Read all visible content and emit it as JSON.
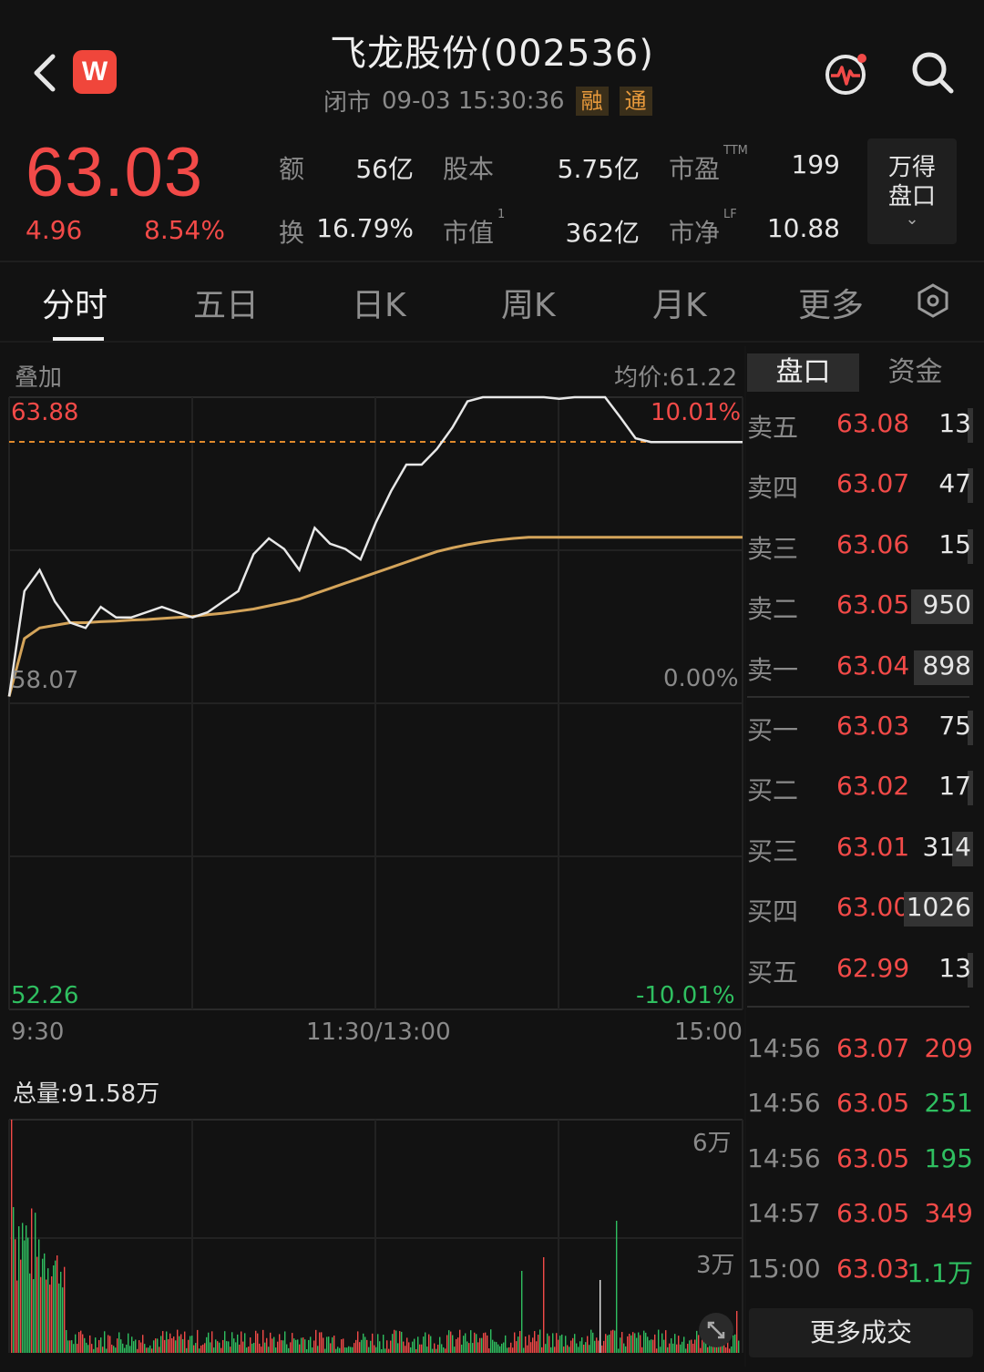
{
  "header": {
    "title": "飞龙股份(002536)",
    "status": "闭市",
    "datetime": "09-03 15:30:36",
    "tags": [
      "融",
      "通"
    ],
    "logo_letter": "W"
  },
  "quote": {
    "price": "63.03",
    "change": "4.96",
    "change_pct": "8.54%",
    "stats": [
      {
        "label": "额",
        "value": "56亿"
      },
      {
        "label": "股本",
        "value": "5.75亿"
      },
      {
        "label": "市盈",
        "sup": "TTM",
        "value": "199"
      },
      {
        "label": "换",
        "value": "16.79%"
      },
      {
        "label": "市值",
        "sup": "1",
        "value": "362亿"
      },
      {
        "label": "市净",
        "sup": "LF",
        "value": "10.88"
      }
    ],
    "wind_button": [
      "万得",
      "盘口"
    ]
  },
  "tabs": [
    "分时",
    "五日",
    "日K",
    "周K",
    "月K",
    "更多"
  ],
  "chart": {
    "overlay_label": "叠加",
    "avg_price": "均价:61.22",
    "high": "63.88",
    "high_pct": "10.01%",
    "prev_close": "58.07",
    "zero_pct": "0.00%",
    "low": "52.26",
    "low_pct": "-10.01%",
    "time_labels": [
      "9:30",
      "11:30/13:00",
      "15:00"
    ],
    "volume_total": "总量:91.58万",
    "vol_ticks": [
      "6万",
      "3万"
    ]
  },
  "chart_data": {
    "type": "line",
    "y_range": [
      52.26,
      63.88
    ],
    "prev_close": 58.07,
    "x": [
      0,
      5,
      10,
      15,
      20,
      25,
      30,
      35,
      40,
      45,
      50,
      55,
      60,
      65,
      70,
      75,
      80,
      85,
      90,
      95,
      100,
      105,
      110,
      115,
      120,
      125,
      130,
      135,
      140,
      145,
      150,
      155,
      160,
      165,
      170,
      175,
      180,
      185,
      190,
      195,
      200,
      205,
      210,
      215,
      220,
      225,
      230,
      235,
      240
    ],
    "series": [
      {
        "values": [
          58.2,
          60.2,
          60.6,
          60.0,
          59.6,
          59.5,
          59.9,
          59.7,
          59.7,
          59.8,
          59.9,
          59.8,
          59.7,
          59.8,
          60.0,
          60.2,
          60.9,
          61.2,
          61.0,
          60.6,
          61.4,
          61.1,
          61.0,
          60.8,
          61.5,
          62.1,
          62.6,
          62.6,
          62.9,
          63.3,
          63.8,
          63.88,
          63.88,
          63.88,
          63.88,
          63.88,
          63.85,
          63.88,
          63.88,
          63.88,
          63.5,
          63.1,
          63.03,
          63.03,
          63.03,
          63.03,
          63.03,
          63.03,
          63.03
        ]
      },
      {
        "values": [
          58.2,
          59.3,
          59.5,
          59.55,
          59.6,
          59.6,
          59.62,
          59.63,
          59.65,
          59.66,
          59.68,
          59.7,
          59.72,
          59.75,
          59.78,
          59.82,
          59.86,
          59.92,
          59.98,
          60.05,
          60.15,
          60.25,
          60.35,
          60.45,
          60.55,
          60.65,
          60.75,
          60.85,
          60.95,
          61.02,
          61.08,
          61.13,
          61.17,
          61.2,
          61.22,
          61.22,
          61.22,
          61.22,
          61.22,
          61.22,
          61.22,
          61.22,
          61.22,
          61.22,
          61.22,
          61.22,
          61.22,
          61.22,
          61.22
        ]
      }
    ]
  },
  "orderbook": {
    "tabs": [
      "盘口",
      "资金"
    ],
    "asks": [
      {
        "label": "卖五",
        "price": "63.08",
        "vol": "13",
        "bar": 0.02
      },
      {
        "label": "卖四",
        "price": "63.07",
        "vol": "47",
        "bar": 0.05
      },
      {
        "label": "卖三",
        "price": "63.06",
        "vol": "15",
        "bar": 0.02
      },
      {
        "label": "卖二",
        "price": "63.05",
        "vol": "950",
        "bar": 0.9
      },
      {
        "label": "卖一",
        "price": "63.04",
        "vol": "898",
        "bar": 0.86
      }
    ],
    "bids": [
      {
        "label": "买一",
        "price": "63.03",
        "vol": "75",
        "bar": 0.07
      },
      {
        "label": "买二",
        "price": "63.02",
        "vol": "17",
        "bar": 0.02
      },
      {
        "label": "买三",
        "price": "63.01",
        "vol": "314",
        "bar": 0.3
      },
      {
        "label": "买四",
        "price": "63.00",
        "vol": "1026",
        "bar": 1.0
      },
      {
        "label": "买五",
        "price": "62.99",
        "vol": "13",
        "bar": 0.02
      }
    ]
  },
  "trades": [
    {
      "time": "14:56",
      "price": "63.07",
      "vol": "209",
      "dir": "up"
    },
    {
      "time": "14:56",
      "price": "63.05",
      "vol": "251",
      "dir": "down"
    },
    {
      "time": "14:56",
      "price": "63.05",
      "vol": "195",
      "dir": "down"
    },
    {
      "time": "14:57",
      "price": "63.05",
      "vol": "349",
      "dir": "up"
    },
    {
      "time": "15:00",
      "price": "63.03",
      "vol": "1.1万",
      "dir": "down"
    }
  ],
  "more_trades_label": "更多成交",
  "colors": {
    "up": "#f24a48",
    "down": "#2fbf60",
    "avg": "#d4a45a",
    "price_line": "#e8e8e8",
    "dashed": "#e08a2c"
  }
}
